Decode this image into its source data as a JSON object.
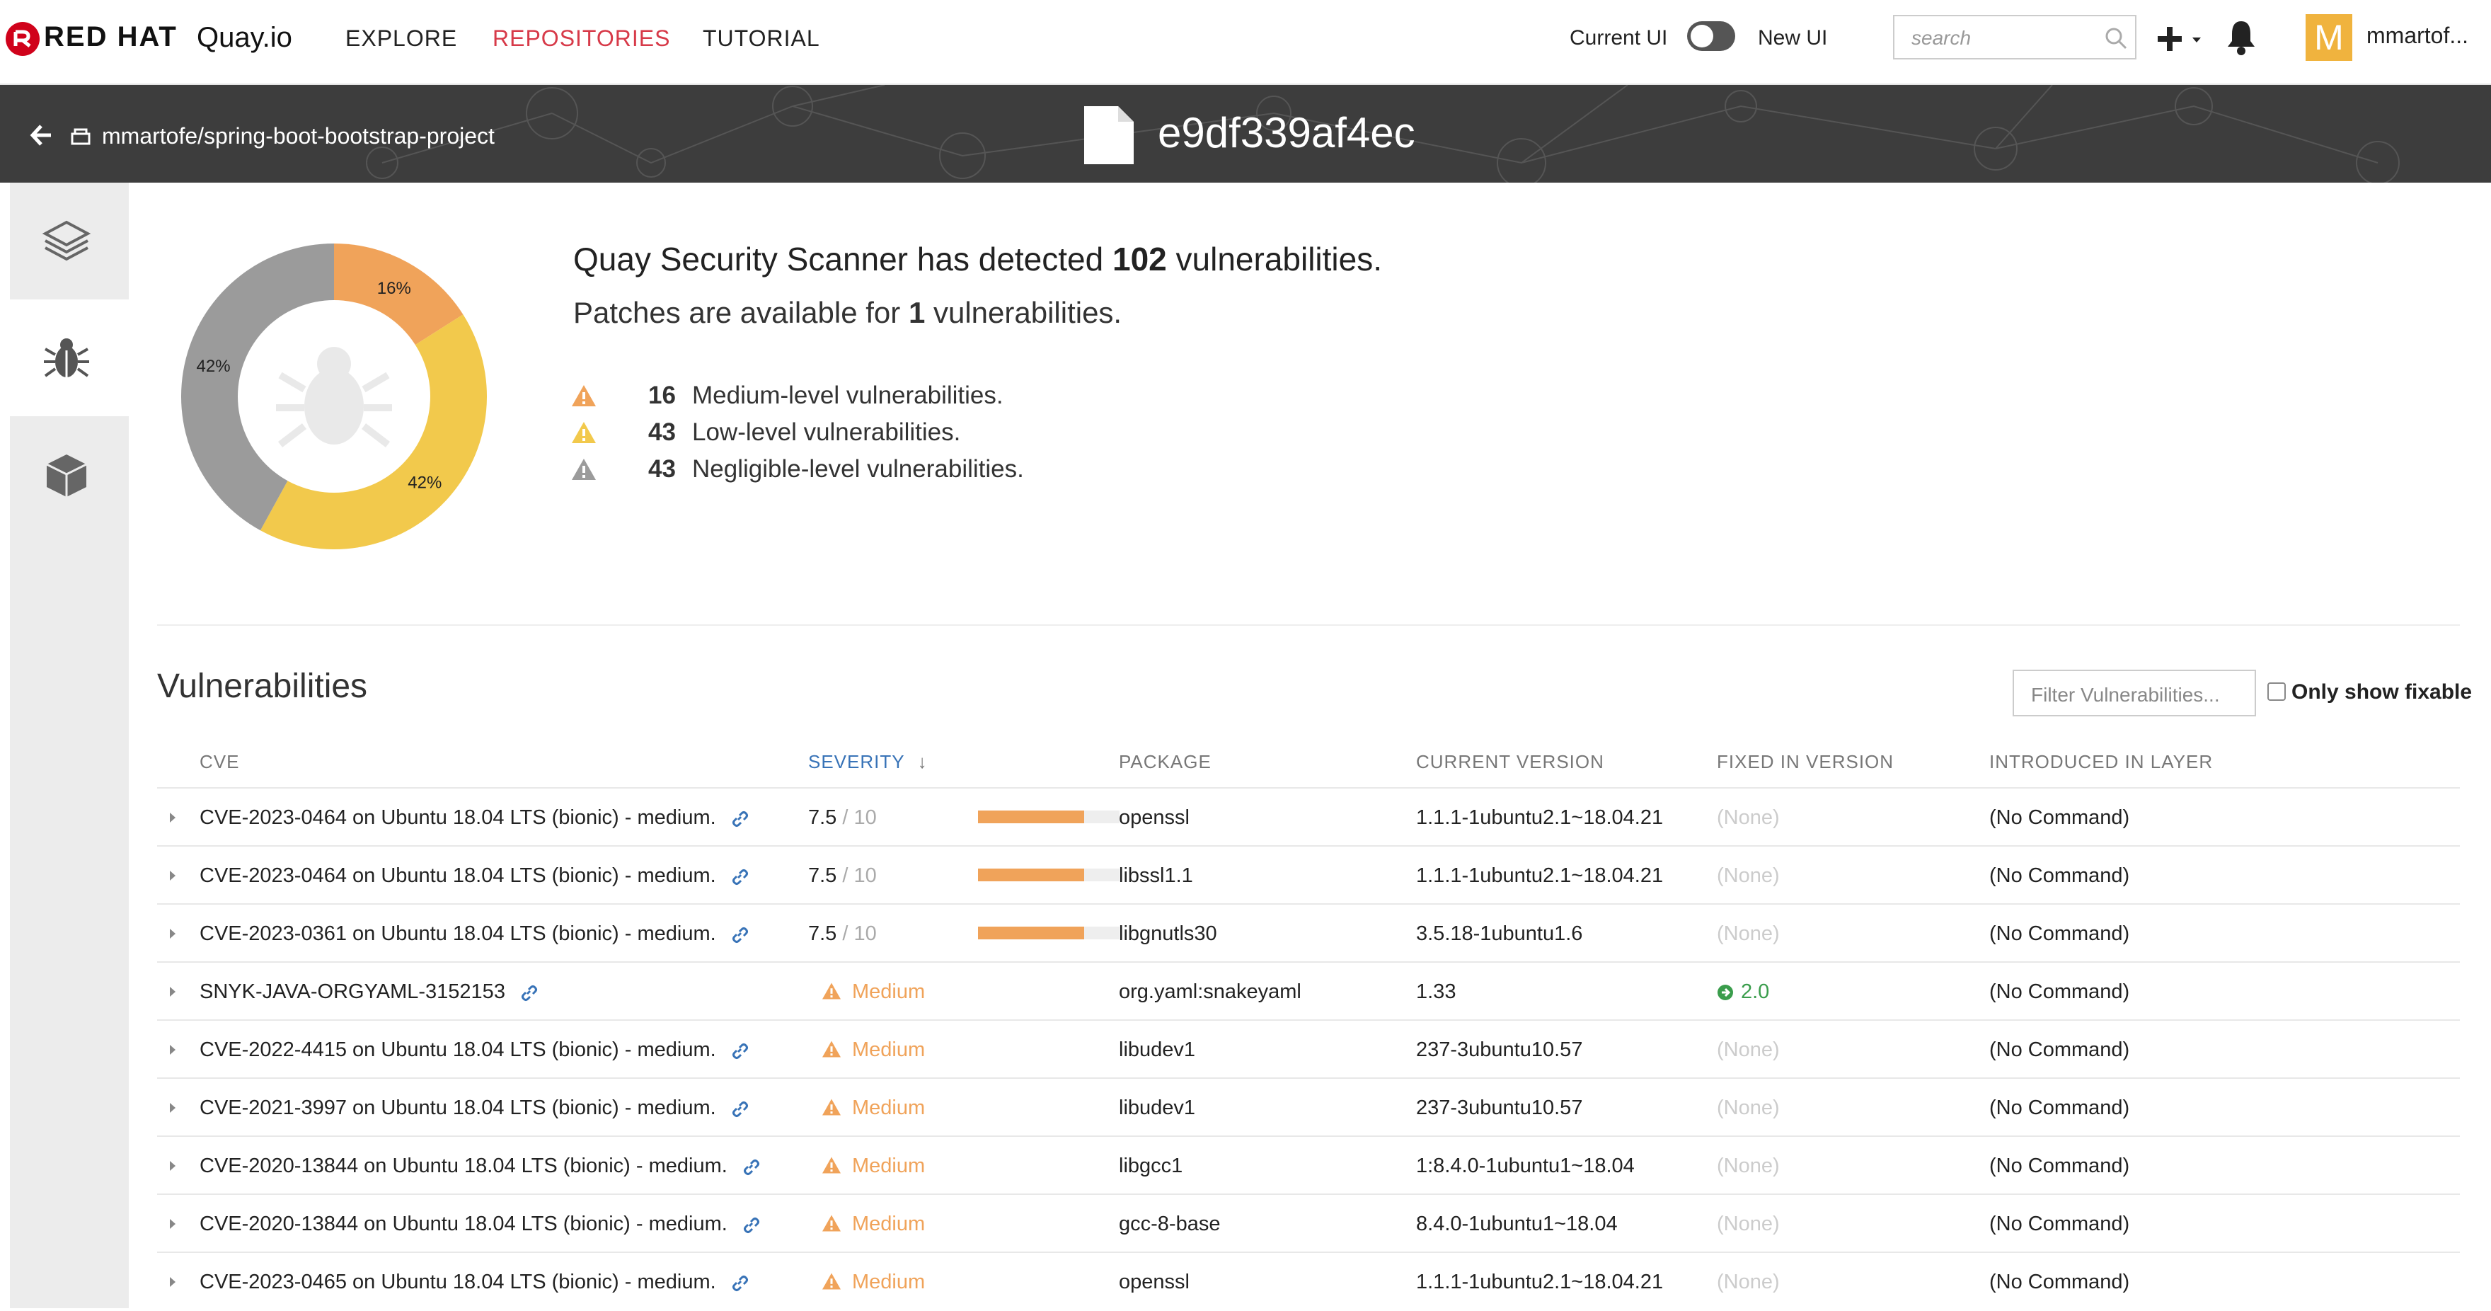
{
  "header": {
    "brand_rh": "RED HAT",
    "brand_quay": "Quay.io",
    "nav": [
      {
        "label": "EXPLORE",
        "active": false
      },
      {
        "label": "REPOSITORIES",
        "active": true
      },
      {
        "label": "TUTORIAL",
        "active": false
      }
    ],
    "toggle_left": "Current UI",
    "toggle_right": "New UI",
    "search_placeholder": "search",
    "avatar_letter": "M",
    "username": "mmartof..."
  },
  "breadcrumb": {
    "repo": "mmartofe/spring-boot-bootstrap-project",
    "tag": "e9df339af4ec"
  },
  "summary": {
    "line1_pre": "Quay Security Scanner has detected ",
    "line1_count": "102",
    "line1_post": " vulnerabilities.",
    "line2_pre": "Patches are available for ",
    "line2_count": "1",
    "line2_post": " vulnerabilities.",
    "levels": [
      {
        "count": "16",
        "label": "Medium-level vulnerabilities.",
        "color": "#f0a35a"
      },
      {
        "count": "43",
        "label": "Low-level vulnerabilities.",
        "color": "#f2c94c"
      },
      {
        "count": "43",
        "label": "Negligible-level vulnerabilities.",
        "color": "#9b9b9b"
      }
    ]
  },
  "chart_data": {
    "type": "pie",
    "categories": [
      "Medium",
      "Low",
      "Negligible"
    ],
    "values": [
      16,
      42,
      42
    ],
    "labels": [
      "16%",
      "42%",
      "42%"
    ],
    "colors": [
      "#f0a35a",
      "#f2c94c",
      "#9b9b9b"
    ]
  },
  "vulns": {
    "title": "Vulnerabilities",
    "filter_placeholder": "Filter Vulnerabilities...",
    "fixable_label": "Only show fixable",
    "columns": [
      "CVE",
      "SEVERITY",
      "PACKAGE",
      "CURRENT VERSION",
      "FIXED IN VERSION",
      "INTRODUCED IN LAYER"
    ],
    "sort_arrow": "↓",
    "rows": [
      {
        "cve": "CVE-2023-0464 on Ubuntu 18.04 LTS (bionic) - medium.",
        "score": "7.5",
        "max": " / 10",
        "pct": 75,
        "severity": "",
        "package": "openssl",
        "current": "1.1.1-1ubuntu2.1~18.04.21",
        "fixed": "(None)",
        "layer": "(No Command)"
      },
      {
        "cve": "CVE-2023-0464 on Ubuntu 18.04 LTS (bionic) - medium.",
        "score": "7.5",
        "max": " / 10",
        "pct": 75,
        "severity": "",
        "package": "libssl1.1",
        "current": "1.1.1-1ubuntu2.1~18.04.21",
        "fixed": "(None)",
        "layer": "(No Command)"
      },
      {
        "cve": "CVE-2023-0361 on Ubuntu 18.04 LTS (bionic) - medium.",
        "score": "7.5",
        "max": " / 10",
        "pct": 75,
        "severity": "",
        "package": "libgnutls30",
        "current": "3.5.18-1ubuntu1.6",
        "fixed": "(None)",
        "layer": "(No Command)"
      },
      {
        "cve": "SNYK-JAVA-ORGYAML-3152153",
        "score": "",
        "max": "",
        "pct": 0,
        "severity": "Medium",
        "package": "org.yaml:snakeyaml",
        "current": "1.33",
        "fixed": "2.0",
        "layer": "(No Command)"
      },
      {
        "cve": "CVE-2022-4415 on Ubuntu 18.04 LTS (bionic) - medium.",
        "score": "",
        "max": "",
        "pct": 0,
        "severity": "Medium",
        "package": "libudev1",
        "current": "237-3ubuntu10.57",
        "fixed": "(None)",
        "layer": "(No Command)"
      },
      {
        "cve": "CVE-2021-3997 on Ubuntu 18.04 LTS (bionic) - medium.",
        "score": "",
        "max": "",
        "pct": 0,
        "severity": "Medium",
        "package": "libudev1",
        "current": "237-3ubuntu10.57",
        "fixed": "(None)",
        "layer": "(No Command)"
      },
      {
        "cve": "CVE-2020-13844 on Ubuntu 18.04 LTS (bionic) - medium.",
        "score": "",
        "max": "",
        "pct": 0,
        "severity": "Medium",
        "package": "libgcc1",
        "current": "1:8.4.0-1ubuntu1~18.04",
        "fixed": "(None)",
        "layer": "(No Command)"
      },
      {
        "cve": "CVE-2020-13844 on Ubuntu 18.04 LTS (bionic) - medium.",
        "score": "",
        "max": "",
        "pct": 0,
        "severity": "Medium",
        "package": "gcc-8-base",
        "current": "8.4.0-1ubuntu1~18.04",
        "fixed": "(None)",
        "layer": "(No Command)"
      },
      {
        "cve": "CVE-2023-0465 on Ubuntu 18.04 LTS (bionic) - medium.",
        "score": "",
        "max": "",
        "pct": 0,
        "severity": "Medium",
        "package": "openssl",
        "current": "1.1.1-1ubuntu2.1~18.04.21",
        "fixed": "(None)",
        "layer": "(No Command)"
      }
    ]
  }
}
